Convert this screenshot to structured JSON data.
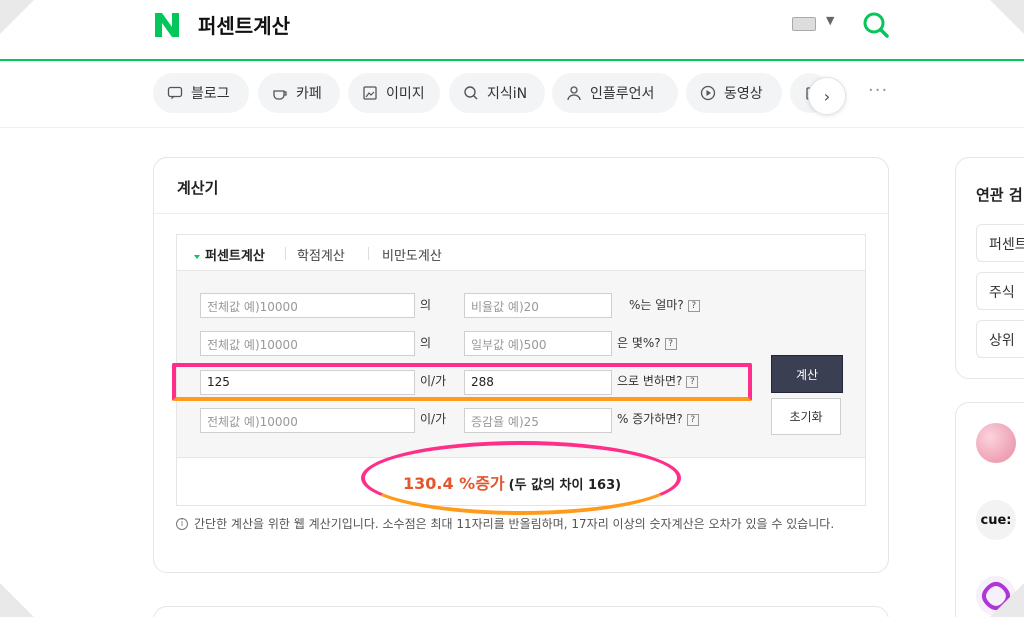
{
  "header": {
    "logo": "N",
    "query": "퍼센트계산",
    "search_icon": "search-icon",
    "keyboard_icon": "keyboard-icon"
  },
  "tabs": [
    {
      "label": "블로그",
      "icon": "blog-icon"
    },
    {
      "label": "카페",
      "icon": "cafe-icon"
    },
    {
      "label": "이미지",
      "icon": "image-icon"
    },
    {
      "label": "지식iN",
      "icon": "knowledge-icon"
    },
    {
      "label": "인플루언서",
      "icon": "influencer-icon"
    },
    {
      "label": "동영상",
      "icon": "video-icon"
    }
  ],
  "tabs_next": "›",
  "tabs_more": "···",
  "calculator": {
    "title": "계산기",
    "sub_tabs": [
      "퍼센트계산",
      "학점계산",
      "비만도계산"
    ],
    "rows": [
      {
        "field1_placeholder": "전체값   예)10000",
        "field1_value": "",
        "joiner": "의",
        "field2_placeholder": "비율값 예)20",
        "field2_value": "",
        "suffix": "%는 얼마?"
      },
      {
        "field1_placeholder": "전체값   예)10000",
        "field1_value": "",
        "joiner": "의",
        "field2_placeholder": "일부값 예)500",
        "field2_value": "",
        "suffix": "은 몇%?"
      },
      {
        "field1_placeholder": "",
        "field1_value": "125",
        "joiner": "이/가",
        "field2_placeholder": "",
        "field2_value": "288",
        "suffix": "으로 변하면?"
      },
      {
        "field1_placeholder": "전체값   예)10000",
        "field1_value": "",
        "joiner": "이/가",
        "field2_placeholder": "증감율   예)25",
        "field2_value": "",
        "suffix": "% 증가하면?"
      }
    ],
    "help_glyph": "?",
    "calc_button": "계산",
    "reset_button": "초기화",
    "result_value": "130.4 %증가",
    "result_diff": "(두 값의 차이 163)",
    "note": "간단한 계산을 위한 웹 계산기입니다. 소수점은 최대 11자리를 반올림하며, 17자리 이상의 숫자계산은 오차가 있을 수 있습니다."
  },
  "sidebar": {
    "title": "연관 검",
    "items": [
      "퍼센트",
      "주식",
      "상위"
    ],
    "profiles": [
      "cue:"
    ]
  },
  "colors": {
    "naver_green": "#03c75a",
    "result_orange": "#e4572e",
    "highlight_pink": "#ff2e88",
    "highlight_orange": "#ff9a1a",
    "calc_button_bg": "#3a3f51"
  }
}
